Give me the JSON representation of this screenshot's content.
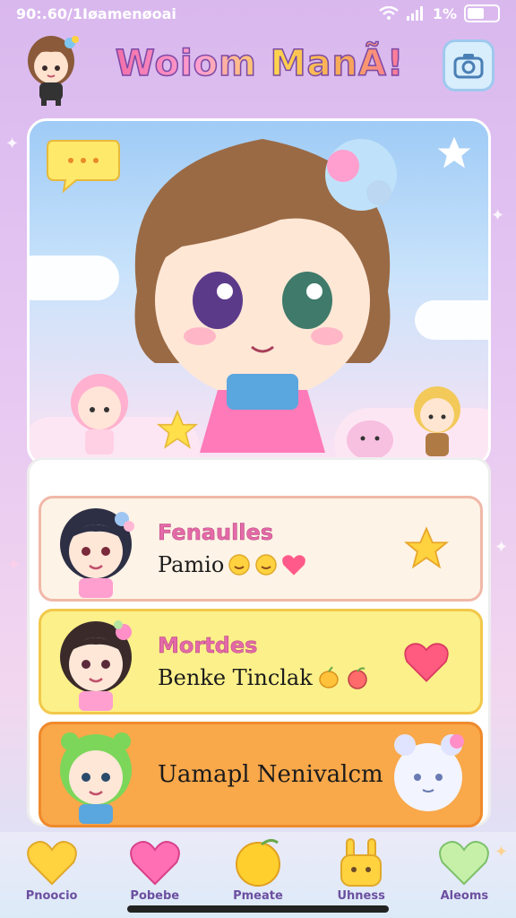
{
  "status_bar": {
    "time": "90:.60/1Iøamenøoai",
    "battery": "1%"
  },
  "header": {
    "title": "Woiom ManÃ!"
  },
  "cards": [
    {
      "title": "Fenaulles",
      "subtitle": "Pamio",
      "color": "#fdf3e6",
      "border": "#f0b8a8"
    },
    {
      "title": "Mortdes",
      "subtitle": "Benke Tinclak",
      "color": "#fbf08a",
      "border": "#f2c84a"
    },
    {
      "title": "",
      "subtitle": "Uamapl Nenivalcm",
      "color": "#f9a84a",
      "border": "#ef8a2c"
    }
  ],
  "nav": [
    {
      "label": "Pnoocio",
      "icon": "heart-yellow-icon",
      "color": "#ffd23f"
    },
    {
      "label": "Pobebe",
      "icon": "heart-pink-icon",
      "color": "#ff6fb3"
    },
    {
      "label": "Pmeate",
      "icon": "lemon-icon",
      "color": "#ffcf2e"
    },
    {
      "label": "Uhness",
      "icon": "bunny-icon",
      "color": "#ffd23f"
    },
    {
      "label": "Aleoms",
      "icon": "heart-mint-icon",
      "color": "#c6f0a8"
    }
  ]
}
